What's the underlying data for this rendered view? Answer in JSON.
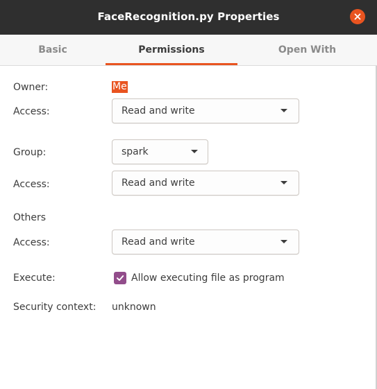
{
  "window": {
    "title": "FaceRecognition.py Properties",
    "close_icon": "close-icon",
    "close_color": "#e95420"
  },
  "tabs": [
    {
      "label": "Basic",
      "active": false
    },
    {
      "label": "Permissions",
      "active": true
    },
    {
      "label": "Open With",
      "active": false
    }
  ],
  "owner": {
    "label": "Owner:",
    "value": "Me",
    "access_label": "Access:",
    "access_value": "Read and write"
  },
  "group": {
    "label": "Group:",
    "value": "spark",
    "access_label": "Access:",
    "access_value": "Read and write"
  },
  "others": {
    "label": "Others",
    "access_label": "Access:",
    "access_value": "Read and write"
  },
  "execute": {
    "label": "Execute:",
    "checkbox_label": "Allow executing file as program",
    "checked": true
  },
  "security": {
    "label": "Security context:",
    "value": "unknown"
  },
  "colors": {
    "accent": "#e95420",
    "checkbox": "#924d8b",
    "titlebar": "#2f2f2f"
  }
}
